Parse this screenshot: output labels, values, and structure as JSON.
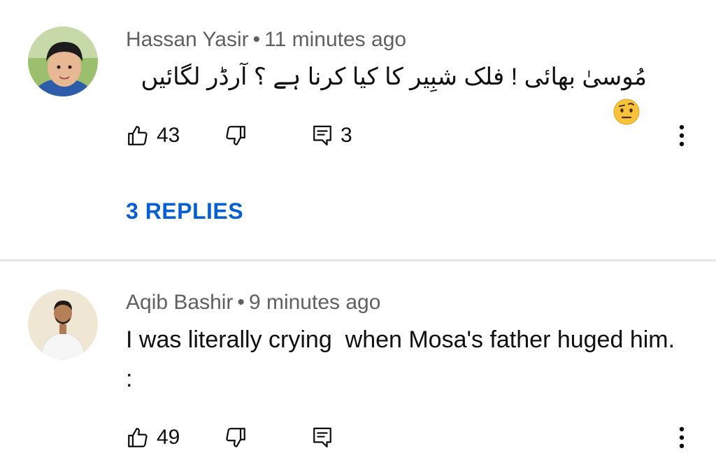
{
  "comments": [
    {
      "author": "Hassan Yasir",
      "separator": "•",
      "time": "11 minutes ago",
      "text": "مُوسیٰ بھائی ! فلک شبِیر کا کیا کرنا ہے ؟ آرڈر لگائیں",
      "emoji": "face-with-raised-eyebrow-emoji",
      "likes": "43",
      "reply_count": "3",
      "replies_label": "3 REPLIES"
    },
    {
      "author": "Aqib Bashir",
      "separator": "•",
      "time": "9 minutes ago",
      "text": "I was literally crying  when Mosa's father huged him. :",
      "likes": "49"
    }
  ],
  "colors": {
    "link": "#065fd4",
    "meta": "#606060",
    "divider": "#e5e5e5"
  }
}
